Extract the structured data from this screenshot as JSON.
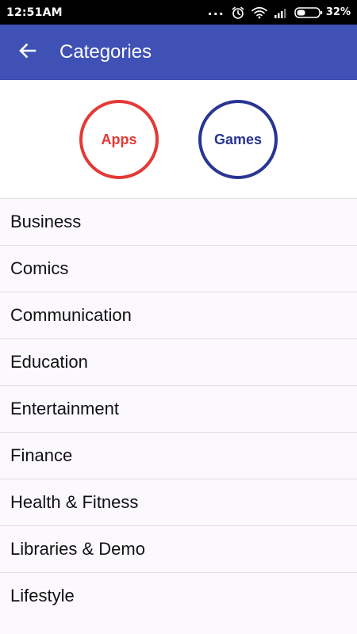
{
  "status_bar": {
    "time": "12:51AM",
    "dots": "...",
    "battery_percent": "32%",
    "icons": [
      "alarm-icon",
      "wifi-icon",
      "signal-icon",
      "battery-icon"
    ]
  },
  "app_bar": {
    "back_icon": "arrow-left-icon",
    "title": "Categories",
    "color": "#3f51b5"
  },
  "toggles": {
    "apps_label": "Apps",
    "apps_color": "#e53935",
    "games_label": "Games",
    "games_color": "#283593"
  },
  "categories": [
    "Business",
    "Comics",
    "Communication",
    "Education",
    "Entertainment",
    "Finance",
    "Health & Fitness",
    "Libraries & Demo",
    "Lifestyle"
  ]
}
